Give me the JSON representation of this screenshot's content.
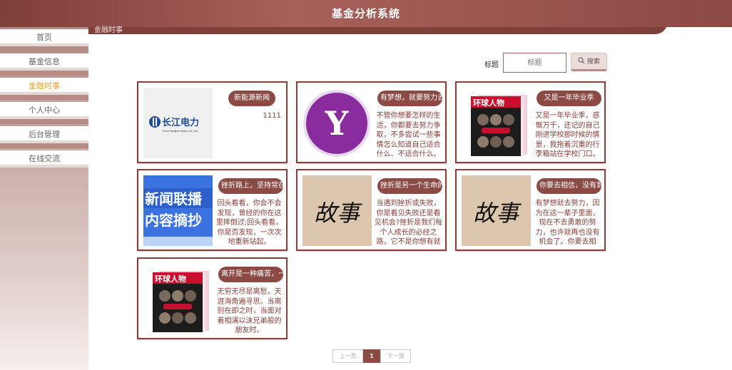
{
  "app": {
    "title": "基金分析系统"
  },
  "breadcrumb": "金融时事",
  "sidebar": {
    "items": [
      {
        "label": "首页"
      },
      {
        "label": "基金信息"
      },
      {
        "label": "金融时事"
      },
      {
        "label": "个人中心"
      },
      {
        "label": "后台管理"
      },
      {
        "label": "在线交流"
      }
    ]
  },
  "search": {
    "label": "标题",
    "placeholder": "标题",
    "button_label": "搜索",
    "icon": "search-icon"
  },
  "cards": [
    {
      "title": "新能源新闻",
      "text": "1111",
      "image": "changjiang-power-logo",
      "logo_text": "长江电力",
      "logo_sub": "China Yangtze Power Co.,Ltd"
    },
    {
      "title": "有梦想，就要努力去实现",
      "text": "不管你想要怎样的生活，你都要去努力争取，不多尝试一些事情怎么知道自己适合什么、不适合什么。",
      "image": "yahoo-logo",
      "logo_text": "Y"
    },
    {
      "title": "又是一年毕业季",
      "text": "又是一年毕业季，感慨万千，还记的自己刚进学校那时候的情景，我拖着沉重的行李箱站在学校门口。",
      "image": "magazine-cover",
      "logo_text": "环球人物"
    },
    {
      "title": "挫折路上，坚持常在心间",
      "text": "回头看看，你会不会发现，曾经的你在这里摔倒过;回头看看，你是否发现，一次次地重新站起。",
      "image": "news-banner",
      "logo_text": "新闻联播",
      "logo_sub": "内容摘抄"
    },
    {
      "title": "挫折是另一个生命的开端",
      "text": "当遇到挫折或失败，你是看见失败还是看见机会?挫折是我们每个人成长的必经之路，它不是你想有就有。",
      "image": "calligraphy",
      "logo_text": "故事"
    },
    {
      "title": "你要去相信，没有到不了的明天",
      "text": "有梦想就去努力，因为在这一辈子里面，现在不去勇敢的努力，也许就再也没有机会了。你要去相信。",
      "image": "calligraphy",
      "logo_text": "故事"
    },
    {
      "title": "离开是一种痛苦，一种勇气，一种无奈",
      "text": "无穷无尽是离愁，天涯海角遍寻思。当离别在即之时，当面对着相濡以沫兄弟般的朋友时。",
      "image": "magazine-cover",
      "logo_text": "环球人物"
    }
  ],
  "pagination": {
    "prev": "上一页",
    "current": "1",
    "next": "下一页"
  },
  "colors": {
    "brand": "#8b4a44",
    "active_nav": "#f0a030",
    "card_border": "#8c3d37"
  }
}
